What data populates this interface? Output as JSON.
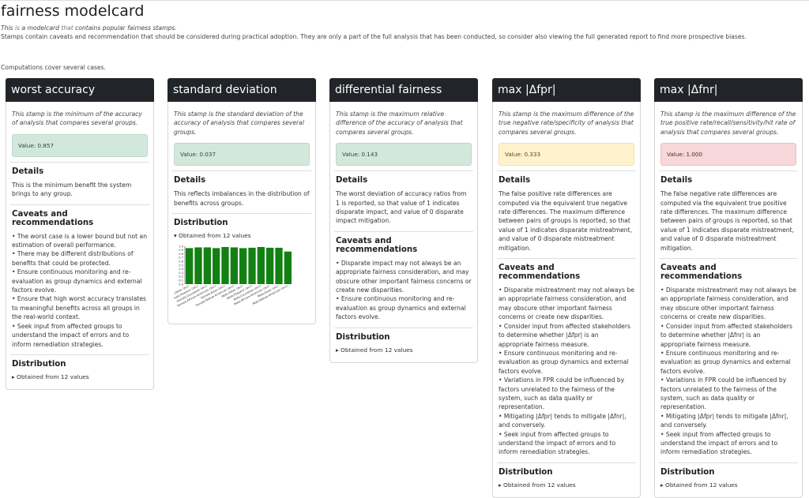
{
  "page": {
    "title": "fairness modelcard",
    "intro_parts": [
      "This",
      " is ",
      "a modelcard",
      " that ",
      "contains popular fairness stamps."
    ],
    "intro2": "Stamps contain caveats and recommendation that should be considered during practical adoption. They are only a part of the full analysis that has been conducted, so consider also viewing the full generated report to find more prospective biases.",
    "cover": "Computations cover several cases."
  },
  "cards": [
    {
      "title": "worst accuracy",
      "desc": "This stamp is the minimum of the accuracy of analysis that compares several groups.",
      "value": "Value: 0.857",
      "status": "green",
      "details_heading": "Details",
      "details": "This is the minimum benefit the system brings to any group.",
      "caveats_heading": "Caveats and recommendations",
      "caveats": [
        "• The worst case is a lower bound but not an estimation of overall performance.",
        "• There may be different distributions of benefits that could be protected.",
        "• Ensure continuous monitoring and re-evaluation as group dynamics and external factors evolve.",
        "• Ensure that high worst accuracy translates to meaningful benefits across all groups in the real-world context.",
        "• Seek input from affected groups to understand the impact of errors and to inform remediation strategies."
      ],
      "dist_heading": "Distribution",
      "dist_summary": "▸ Obtained from 12 values"
    },
    {
      "title": "standard deviation",
      "desc": "This stamp is the standard deviation of the accuracy of analysis that compares several groups.",
      "value": "Value: 0.037",
      "status": "green",
      "details_heading": "Details",
      "details": "This reflects imbalances in the distribution of benefits across groups.",
      "dist_heading": "Distribution",
      "dist_summary": "▾ Obtained from 12 values"
    },
    {
      "title": "differential fairness",
      "desc": "This stamp is the maximum relative difference of the accuracy of analysis that compares several groups.",
      "value": "Value: 0.143",
      "status": "green",
      "details_heading": "Details",
      "details": "The worst deviation of accuracy ratios from 1 is reported, so that value of 1 indicates disparate impact, and value of 0 disparate impact mitigation.",
      "caveats_heading": "Caveats and recommendations",
      "caveats": [
        "• Disparate impact may not always be an appropriate fairness consideration, and may obscure other important fairness concerns or create new disparities.",
        "• Ensure continuous monitoring and re-evaluation as group dynamics and external factors evolve."
      ],
      "dist_heading": "Distribution",
      "dist_summary": "▸ Obtained from 12 values"
    },
    {
      "title": "max |Δfpr|",
      "desc": "This stamp is the maximum difference of the true negative rate/specificity of analysis that compares several groups.",
      "value": "Value: 0.333",
      "status": "yellow",
      "details_heading": "Details",
      "details": "The false positive rate differences are computed via the equivalent true negative rate differences. The maximum difference between pairs of groups is reported, so that value of 1 indicates disparate mistreatment, and value of 0 disparate mistreatment mitigation.",
      "caveats_heading": "Caveats and recommendations",
      "caveats": [
        "• Disparate mistreatment may not always be an appropriate fairness consideration, and may obscure other important fairness concerns or create new disparities.",
        "• Consider input from affected stakeholders to determine whether |Δfpr| is an appropriate fairness measure.",
        "• Ensure continuous monitoring and re-evaluation as group dynamics and external factors evolve.",
        "• Variations in FPR could be influenced by factors unrelated to the fairness of the system, such as data quality or representation.",
        "• Mitigating |Δfpr| tends to mitigate |Δfnr|, and conversely.",
        "• Seek input from affected groups to understand the impact of errors and to inform remediation strategies."
      ],
      "dist_heading": "Distribution",
      "dist_summary": "▸ Obtained from 12 values"
    },
    {
      "title": "max |Δfnr|",
      "desc": "This stamp is the maximum difference of the true positive rate/recall/sensitivity/hit rate of analysis that compares several groups.",
      "value": "Value: 1.000",
      "status": "red",
      "details_heading": "Details",
      "details": "The false negative rate differences are computed via the equivalent true positive rate differences. The maximum difference between pairs of groups is reported, so that value of 1 indicates disparate mistreatment, and value of 0 disparate mistreatment mitigation.",
      "caveats_heading": "Caveats and recommendations",
      "caveats": [
        "• Disparate mistreatment may not always be an appropriate fairness consideration, and may obscure other important fairness concerns or create new disparities.",
        "• Consider input from affected stakeholders to determine whether |Δfnr| is an appropriate fairness measure.",
        "• Ensure continuous monitoring and re-evaluation as group dynamics and external factors evolve.",
        "• Variations in FPR could be influenced by factors unrelated to the fairness of the system, such as data quality or representation.",
        "• Mitigating |Δfpr| tends to mitigate |Δfnr|, and conversely.",
        "• Seek input from affected groups to understand the impact of errors and to inform remediation strategies."
      ],
      "dist_heading": "Distribution",
      "dist_summary": "▸ Obtained from 12 values"
    }
  ],
  "colors": {
    "header": "#212529",
    "bar": "#128012",
    "value_green": "#d3e8dc",
    "value_yellow": "#fff3cd",
    "value_red": "#f8d7da"
  },
  "chart_data": {
    "type": "bar",
    "categories": [
      "Female,Other (acc)",
      "Female,Hispanic (acc)",
      "Female,Caucasian (acc)",
      "Female,African-American (acc)",
      "Female,Asian (acc)",
      "Female,Native American (acc)",
      "Male,Other (acc)",
      "Male,Hispanic (acc)",
      "Male,Caucasian (acc)",
      "Male,African-American (acc)",
      "Male,Asian (acc)",
      "Male,Native American (acc)"
    ],
    "values": [
      0.95,
      0.97,
      0.97,
      0.95,
      0.98,
      0.97,
      0.95,
      0.96,
      0.98,
      0.96,
      0.96,
      0.86
    ],
    "yticks": [
      "0.0",
      "0.1",
      "0.2",
      "0.3",
      "0.4",
      "0.5",
      "0.6",
      "0.7",
      "0.8",
      "0.9",
      "1.0"
    ],
    "ylim": [
      0,
      1
    ],
    "title": "",
    "xlabel": "",
    "ylabel": ""
  }
}
